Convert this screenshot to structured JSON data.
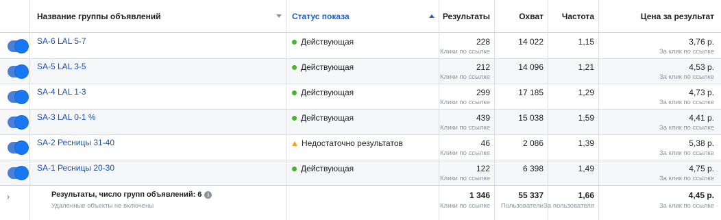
{
  "header": {
    "name": "Название группы объявлений",
    "status": "Статус показа",
    "results": "Результаты",
    "reach": "Охват",
    "frequency": "Частота",
    "cost": "Цена за результат"
  },
  "rows": [
    {
      "name": "SA-6 LAL 5-7",
      "status": "Действующая",
      "status_type": "active",
      "results": "228",
      "results_sub": "Клики по ссылке",
      "reach": "14 022",
      "frequency": "1,15",
      "cost": "3,76 р.",
      "cost_sub": "За клик по ссылке"
    },
    {
      "name": "SA-5 LAL 3-5",
      "status": "Действующая",
      "status_type": "active",
      "results": "212",
      "results_sub": "Клики по ссылке",
      "reach": "14 096",
      "frequency": "1,21",
      "cost": "4,53 р.",
      "cost_sub": "За клик по ссылке"
    },
    {
      "name": "SA-4 LAL 1-3",
      "status": "Действующая",
      "status_type": "active",
      "results": "299",
      "results_sub": "Клики по ссылке",
      "reach": "17 185",
      "frequency": "1,29",
      "cost": "4,73 р.",
      "cost_sub": "За клик по ссылке"
    },
    {
      "name": "SA-3 LAL 0-1 %",
      "status": "Действующая",
      "status_type": "active",
      "results": "439",
      "results_sub": "Клики по ссылке",
      "reach": "15 038",
      "frequency": "1,59",
      "cost": "4,41 р.",
      "cost_sub": "За клик по ссылке"
    },
    {
      "name": "SA-2 Ресницы 31-40",
      "status": "Недостаточно результатов",
      "status_type": "warning",
      "results": "46",
      "results_sub": "Клики по ссылке",
      "reach": "2 086",
      "frequency": "1,39",
      "cost": "5,38 р.",
      "cost_sub": "За клик по ссылке"
    },
    {
      "name": "SA-1 Ресницы 20-30",
      "status": "Действующая",
      "status_type": "active",
      "results": "122",
      "results_sub": "Клики по ссылке",
      "reach": "6 398",
      "frequency": "1,49",
      "cost": "4,75 р.",
      "cost_sub": "За клик по ссылке"
    }
  ],
  "summary": {
    "title": "Результаты, число групп объявлений: 6",
    "note": "Удаленные объекты не включены",
    "results": "1 346",
    "results_sub": "Клики по ссылке",
    "reach": "55 337",
    "reach_sub": "Пользователи",
    "frequency": "1,66",
    "frequency_sub": "За пользователя",
    "cost": "4,45 р.",
    "cost_sub": "За клик по ссылке"
  },
  "colors": {
    "toggle_on": "#1877f2",
    "status_active": "#42b72a",
    "status_warning": "#f7a21b",
    "link": "#1a4fb0"
  },
  "icons": {
    "sort_name": "sort-down-icon",
    "sort_status": "sort-up-icon",
    "status_active": "green-dot-icon",
    "status_warning": "warning-triangle-icon",
    "expand": "chevron-right-icon",
    "info": "info-icon"
  }
}
